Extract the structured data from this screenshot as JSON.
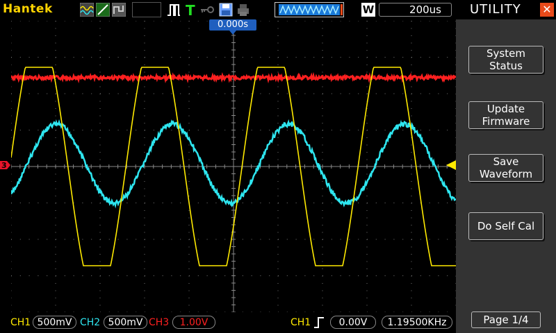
{
  "header": {
    "brand": "Hantek",
    "timebase": "200us",
    "mode_badge": "W",
    "trigger_position": "0.000s"
  },
  "channels": [
    {
      "label": "CH1",
      "scale": "500mV",
      "color": "#ffea00"
    },
    {
      "label": "CH2",
      "scale": "500mV",
      "color": "#2ee6f0"
    },
    {
      "label": "CH3",
      "scale": "1.00V",
      "color": "#ff2020"
    }
  ],
  "trigger": {
    "source": "CH1",
    "level": "0.00V",
    "frequency": "1.19500KHz"
  },
  "markers": {
    "ch3_ground": "3"
  },
  "panel": {
    "title": "UTILITY",
    "buttons": [
      {
        "label": "System\nStatus"
      },
      {
        "label": "Update\nFirmware"
      },
      {
        "label": "Save\nWaveform"
      },
      {
        "label": "Do Self Cal"
      }
    ],
    "page": "Page 1/4"
  }
}
